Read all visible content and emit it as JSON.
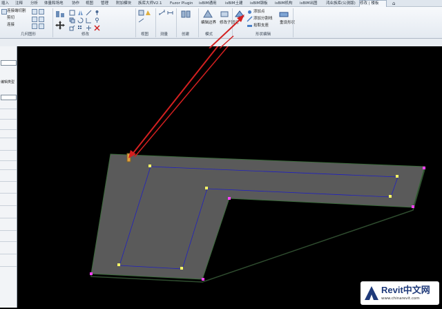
{
  "menu": {
    "tabs": [
      "插入",
      "注释",
      "分析",
      "体量和场地",
      "协作",
      "视图",
      "管理",
      "附加模块",
      "族库大师V2.1",
      "Fuzor Plugin",
      "isBIM通用",
      "isBIM土建",
      "isBIM钢板",
      "isBIM机构",
      "isBIM出图",
      "鸿业族库(公测版)",
      "修改 | 楼板"
    ]
  },
  "ribbon": {
    "clipboard": {
      "connect": "连接端切割",
      "cut": "剪切",
      "join": "连接"
    },
    "panels": {
      "geometry": "几何图形",
      "modify": "修改",
      "view": "视图",
      "measure": "测量",
      "create": "创建",
      "mode": "模式",
      "shape_edit": "形状编辑"
    },
    "mode_tools": {
      "edit_boundary": "编辑边界",
      "modify_sub": "修改子图元"
    },
    "shape_tools": {
      "add_point": "添加点",
      "add_split_line": "添加分割线",
      "pick_support": "拾取支座",
      "reset_shape": "重设形状"
    },
    "tab_label": "修改 | 楼板",
    "help_glyph": "⌂"
  },
  "props": {
    "type_label": "编辑类型"
  },
  "watermark": {
    "brand": "Revit中文网",
    "url": "www.chinarevit.com"
  },
  "colors": {
    "slab": "#5a5a5a",
    "slab_edge": "#3a6a3a",
    "inner_line": "#2020c0",
    "arrow": "#d42020",
    "point_yellow": "#ffff66",
    "point_pink": "#ff40ff"
  }
}
